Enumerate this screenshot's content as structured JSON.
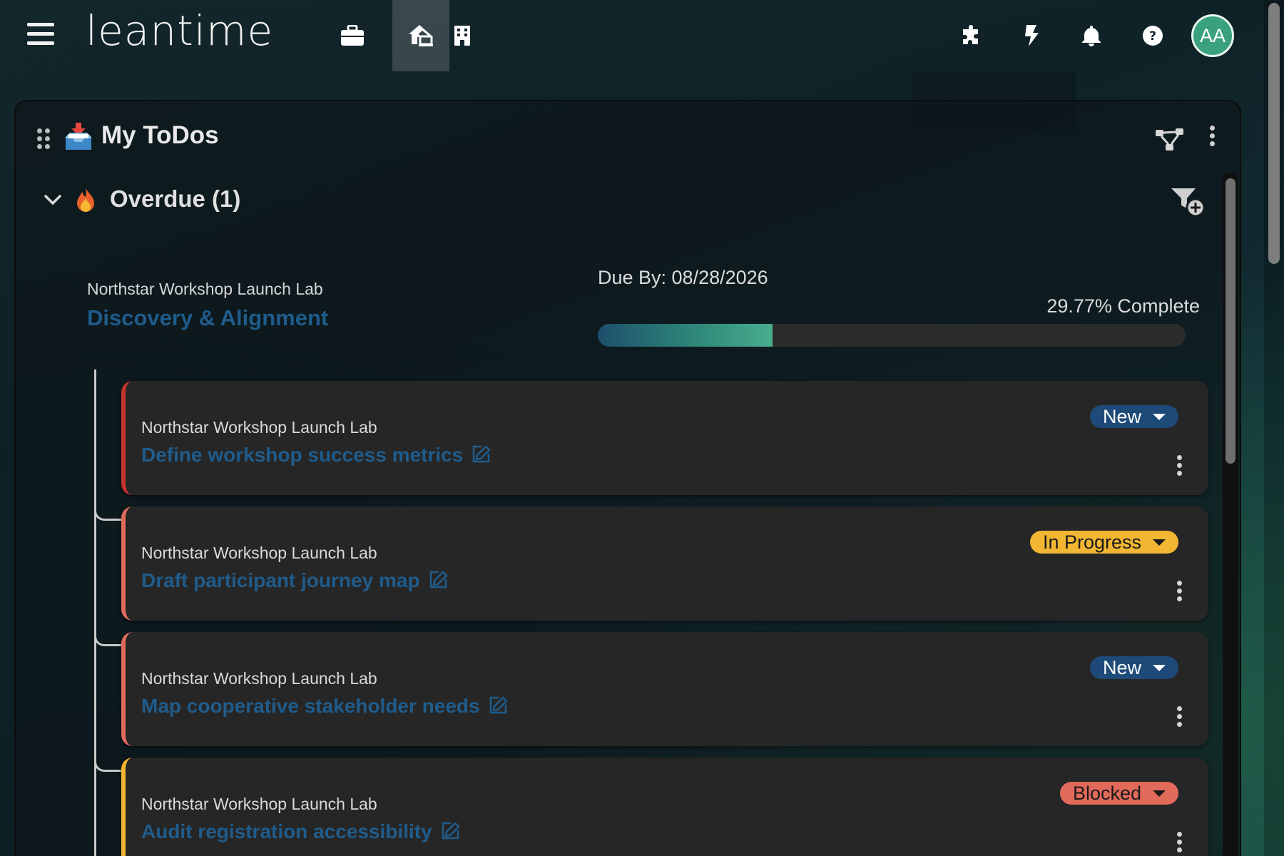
{
  "header": {
    "logo_text": "leantime",
    "nav": [
      {
        "name": "briefcase-icon",
        "label": "Projects"
      },
      {
        "name": "home-office-icon",
        "label": "My Work",
        "active": true
      },
      {
        "name": "building-icon",
        "label": "Company"
      }
    ],
    "right_icons": [
      "puzzle-icon",
      "bolt-icon",
      "bell-icon",
      "help-icon"
    ],
    "avatar_initials": "AA"
  },
  "widget": {
    "title": "My ToDos",
    "group": {
      "title": "Overdue (1)",
      "milestone": {
        "project": "Northstar Workshop Launch Lab",
        "title": "Discovery & Alignment",
        "due": "Due By: 08/28/2026",
        "percent_text": "29.77% Complete",
        "percent": 29.77
      },
      "tasks": [
        {
          "project": "Northstar Workshop Launch Lab",
          "title": "Define workshop success metrics",
          "status": "New"
        },
        {
          "project": "Northstar Workshop Launch Lab",
          "title": "Draft participant journey map",
          "status": "In Progress"
        },
        {
          "project": "Northstar Workshop Launch Lab",
          "title": "Map cooperative stakeholder needs",
          "status": "New"
        },
        {
          "project": "Northstar Workshop Launch Lab",
          "title": "Audit registration accessibility",
          "status": "Blocked"
        }
      ]
    }
  },
  "colors": {
    "status_new_bg": "#1e4a7a",
    "status_new_fg": "#ffffff",
    "status_progress_bg": "#f2b632",
    "status_progress_fg": "#1a1a1a",
    "status_blocked_bg": "#e26a5b",
    "status_blocked_fg": "#1a1a1a",
    "link": "#1f5c8c",
    "accent_green": "#3aa17e"
  }
}
